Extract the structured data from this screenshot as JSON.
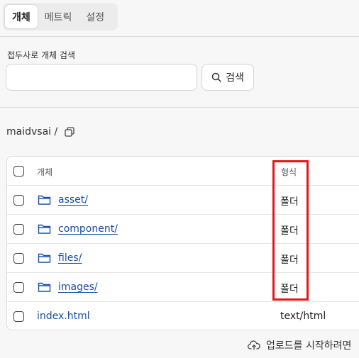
{
  "tabs": [
    {
      "label": "개체"
    },
    {
      "label": "메트릭"
    },
    {
      "label": "설정"
    }
  ],
  "search": {
    "label": "접두사로 개체 검색",
    "value": "",
    "placeholder": "",
    "button_label": "검색"
  },
  "breadcrumb": {
    "path": "maidvsai /"
  },
  "table": {
    "headers": {
      "name": "개체",
      "type": "형식"
    },
    "rows": [
      {
        "name": "asset/",
        "type": "폴더",
        "icon": "folder-icon"
      },
      {
        "name": "component/",
        "type": "폴더",
        "icon": "folder-icon"
      },
      {
        "name": "files/",
        "type": "폴더",
        "icon": "folder-icon"
      },
      {
        "name": "images/",
        "type": "폴더",
        "icon": "folder-icon"
      },
      {
        "name": "index.html",
        "type": "text/html",
        "icon": ""
      }
    ]
  },
  "upload": {
    "text": "업로드를 시작하려면"
  },
  "colors": {
    "link": "#1a4ea8",
    "highlight": "#e5151b",
    "background": "#f7f7f7"
  }
}
